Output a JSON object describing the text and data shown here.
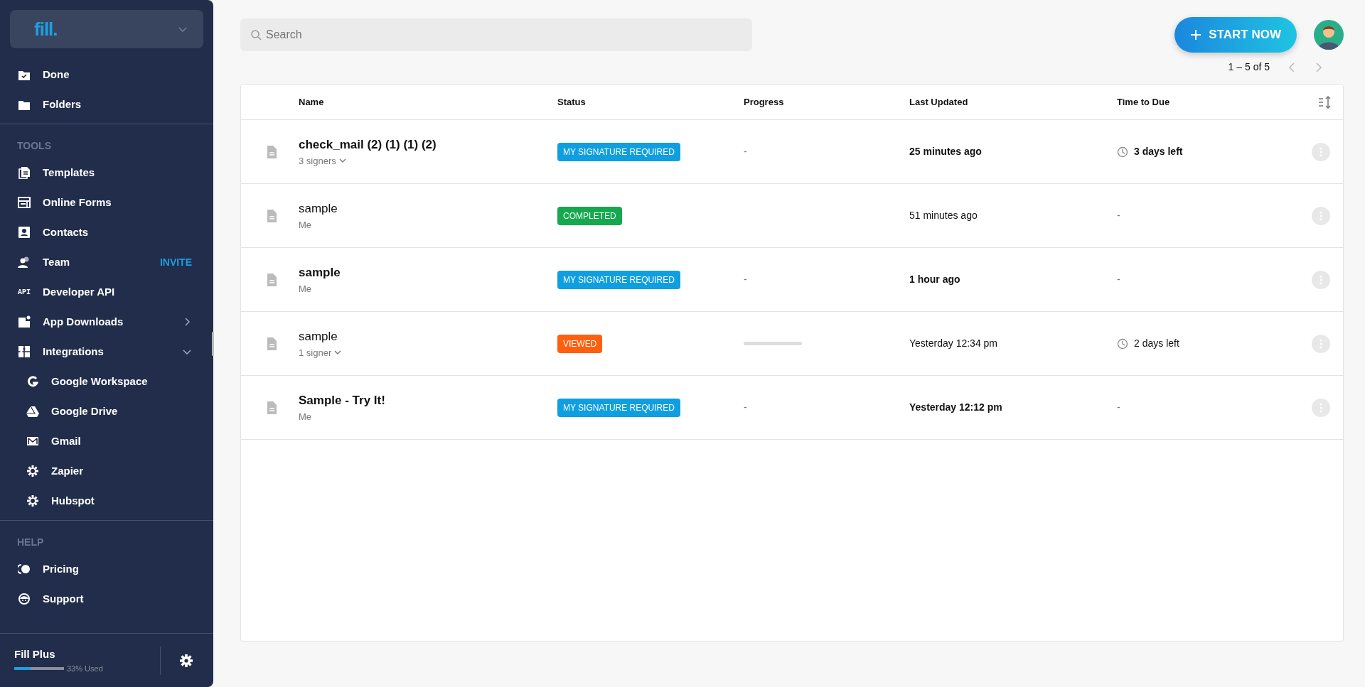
{
  "sidebar": {
    "logo": "fill.",
    "top_items": [
      {
        "label": "Done"
      },
      {
        "label": "Folders"
      }
    ],
    "sections": [
      {
        "heading": "TOOLS",
        "items": [
          {
            "label": "Templates"
          },
          {
            "label": "Online Forms"
          },
          {
            "label": "Contacts"
          },
          {
            "label": "Team",
            "action": "INVITE"
          },
          {
            "label": "Developer API",
            "icon_text": "API"
          },
          {
            "label": "App Downloads",
            "expanded": false
          },
          {
            "label": "Integrations",
            "expanded": true,
            "children": [
              {
                "label": "Google Workspace"
              },
              {
                "label": "Google Drive"
              },
              {
                "label": "Gmail"
              },
              {
                "label": "Zapier"
              },
              {
                "label": "Hubspot"
              }
            ]
          }
        ]
      },
      {
        "heading": "HELP",
        "items": [
          {
            "label": "Pricing"
          },
          {
            "label": "Support"
          }
        ]
      }
    ],
    "plan": {
      "name": "Fill Plus",
      "level": 0.33,
      "usage": "33% Used"
    }
  },
  "search": {
    "placeholder": "Search"
  },
  "start_button": {
    "label": "START NOW"
  },
  "pagination": {
    "text": "1 – 5 of 5"
  },
  "table": {
    "columns": [
      "Name",
      "Status",
      "Progress",
      "Last Updated",
      "Time to Due"
    ],
    "rows": [
      {
        "name": "check_mail (2) (1) (1) (2)",
        "subtitle": "3 signers",
        "expandable": true,
        "unread": true,
        "status": {
          "text": "MY SIGNATURE REQUIRED",
          "color": "#0f9fe0"
        },
        "progress": {
          "kind": "text",
          "text": "-"
        },
        "updated": "25 minutes ago",
        "due": {
          "text": "3 days left",
          "clock": true
        }
      },
      {
        "name": "sample",
        "subtitle": "Me",
        "expandable": false,
        "unread": false,
        "status": {
          "text": "COMPLETED",
          "color": "#15a84e"
        },
        "updated": "51 minutes ago",
        "due": {
          "text": "-",
          "clock": false
        }
      },
      {
        "name": "sample",
        "subtitle": "Me",
        "expandable": false,
        "unread": true,
        "status": {
          "text": "MY SIGNATURE REQUIRED",
          "color": "#0f9fe0"
        },
        "progress": {
          "kind": "text",
          "text": "-"
        },
        "updated": "1 hour ago",
        "due": {
          "text": "-",
          "clock": false
        }
      },
      {
        "name": "sample",
        "subtitle": "1 signer",
        "expandable": true,
        "unread": false,
        "status": {
          "text": "VIEWED",
          "color": "#ff5f0f"
        },
        "progress": {
          "kind": "bar",
          "level": 0
        },
        "updated": "Yesterday 12:34 pm",
        "due": {
          "text": "2 days left",
          "clock": true
        }
      },
      {
        "name": "Sample - Try It!",
        "subtitle": "Me",
        "expandable": false,
        "unread": true,
        "status": {
          "text": "MY SIGNATURE REQUIRED",
          "color": "#0f9fe0"
        },
        "progress": {
          "kind": "text",
          "text": "-"
        },
        "updated": "Yesterday 12:12 pm",
        "due": {
          "text": "-",
          "clock": false
        }
      }
    ]
  }
}
